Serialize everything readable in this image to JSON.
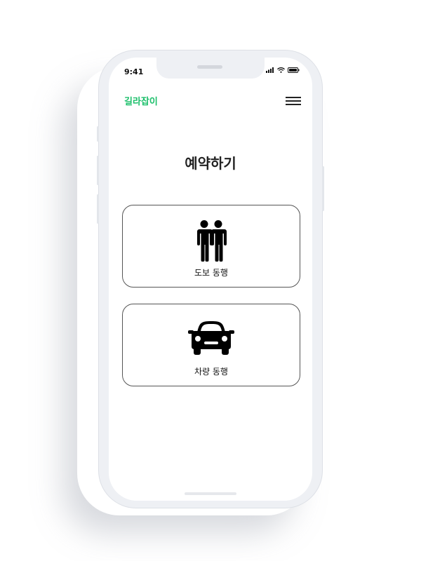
{
  "status_bar": {
    "time": "9:41"
  },
  "header": {
    "logo": "길라잡이",
    "menu_icon": "hamburger-menu-icon",
    "logo_color": "#1bbf6a"
  },
  "main": {
    "title": "예약하기",
    "options": [
      {
        "label": "도보 동행",
        "icon": "two-people-icon"
      },
      {
        "label": "차량 동행",
        "icon": "car-icon"
      }
    ]
  }
}
